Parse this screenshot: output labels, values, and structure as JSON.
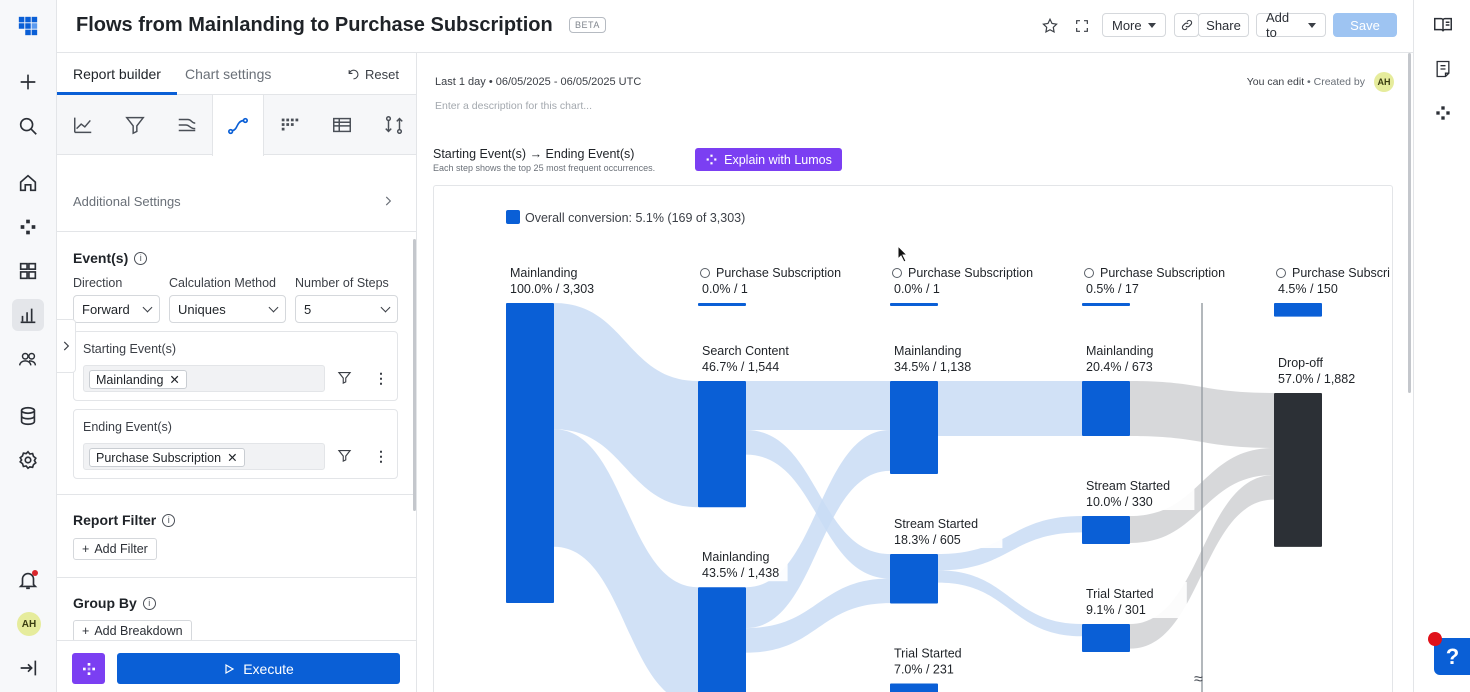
{
  "rail": {
    "logo": "grid-logo-icon",
    "items": [
      "plus-icon",
      "search-icon",
      "home-icon",
      "nodes-icon",
      "dashboard-icon",
      "reports-icon",
      "users-icon",
      "database-icon",
      "settings-icon",
      "bell-icon"
    ],
    "avatar": "AH"
  },
  "header": {
    "title": "Flows from Mainlanding to Purchase Subscription",
    "beta": "BETA",
    "more": "More",
    "share": "Share",
    "add_to": "Add to",
    "save": "Save"
  },
  "panel": {
    "tabs": [
      "Report builder",
      "Chart settings"
    ],
    "reset": "Reset",
    "additional_settings": "Additional Settings",
    "events": {
      "title": "Event(s)",
      "direction_label": "Direction",
      "direction": "Forward",
      "calc_label": "Calculation Method",
      "calc": "Uniques",
      "steps_label": "Number of Steps",
      "steps": "5",
      "starting_label": "Starting Event(s)",
      "starting_chip": "Mainlanding",
      "ending_label": "Ending Event(s)",
      "ending_chip": "Purchase Subscription"
    },
    "report_filter": {
      "title": "Report Filter",
      "button": "Add Filter"
    },
    "group_by": {
      "title": "Group By",
      "button": "Add Breakdown"
    },
    "execute": "Execute"
  },
  "main": {
    "daterange": "Last 1 day • 06/05/2025 - 06/05/2025 UTC",
    "description_placeholder": "Enter a description for this chart...",
    "can_edit": "You can edit",
    "created_by": " • Created by",
    "avatar": "AH",
    "flow_title": "Starting Event(s) → Ending Event(s)",
    "flow_subtitle": "Each step shows the top 25 most frequent occurrences.",
    "explain": "Explain with Lumos"
  },
  "colors": {
    "primary": "#0a5fd6",
    "lumos": "#7b3ff2",
    "flow": "#c9dcf5",
    "dropoff": "#2c3036",
    "gray_flow": "#d3d4d6"
  },
  "chart_data": {
    "type": "sankey",
    "legend": "Overall conversion: 5.1% (169 of 3,303)",
    "nodes": [
      {
        "id": "s0-mainlanding",
        "step": 0,
        "label": "Mainlanding",
        "value_text": "100.0% / 3,303",
        "value": 3303
      },
      {
        "id": "s1-purchase",
        "step": 1,
        "label": "Purchase Subscription",
        "value_text": "0.0% / 1",
        "value": 1,
        "goal": true
      },
      {
        "id": "s1-search",
        "step": 1,
        "label": "Search Content",
        "value_text": "46.7% / 1,544",
        "value": 1544
      },
      {
        "id": "s1-mainlanding",
        "step": 1,
        "label": "Mainlanding",
        "value_text": "43.5% / 1,438",
        "value": 1438
      },
      {
        "id": "s2-purchase",
        "step": 2,
        "label": "Purchase Subscription",
        "value_text": "0.0% / 1",
        "value": 1,
        "goal": true
      },
      {
        "id": "s2-mainlanding",
        "step": 2,
        "label": "Mainlanding",
        "value_text": "34.5% / 1,138",
        "value": 1138
      },
      {
        "id": "s2-stream",
        "step": 2,
        "label": "Stream Started",
        "value_text": "18.3% / 605",
        "value": 605
      },
      {
        "id": "s2-trial",
        "step": 2,
        "label": "Trial Started",
        "value_text": "7.0% / 231",
        "value": 231
      },
      {
        "id": "s3-purchase",
        "step": 3,
        "label": "Purchase Subscription",
        "value_text": "0.5% / 17",
        "value": 17,
        "goal": true
      },
      {
        "id": "s3-mainlanding",
        "step": 3,
        "label": "Mainlanding",
        "value_text": "20.4% / 673",
        "value": 673
      },
      {
        "id": "s3-stream",
        "step": 3,
        "label": "Stream Started",
        "value_text": "10.0% / 330",
        "value": 330
      },
      {
        "id": "s3-trial",
        "step": 3,
        "label": "Trial Started",
        "value_text": "9.1% / 301",
        "value": 301
      },
      {
        "id": "s4-purchase",
        "step": 4,
        "label": "Purchase Subscri",
        "value_text": "4.5% / 150",
        "value": 150,
        "goal": true
      },
      {
        "id": "s4-dropoff",
        "step": 4,
        "label": "Drop-off",
        "value_text": "57.0% / 1,882",
        "value": 1882,
        "dropoff": true
      }
    ],
    "links": [
      {
        "from": "s0-mainlanding",
        "to": "s1-search",
        "value": 1544
      },
      {
        "from": "s0-mainlanding",
        "to": "s1-mainlanding",
        "value": 1438
      },
      {
        "from": "s1-search",
        "to": "s2-mainlanding",
        "value": 600
      },
      {
        "from": "s1-search",
        "to": "s2-stream",
        "value": 300
      },
      {
        "from": "s1-mainlanding",
        "to": "s2-mainlanding",
        "value": 500
      },
      {
        "from": "s1-mainlanding",
        "to": "s2-stream",
        "value": 300
      },
      {
        "from": "s2-mainlanding",
        "to": "s3-mainlanding",
        "value": 673
      },
      {
        "from": "s2-stream",
        "to": "s3-stream",
        "value": 200
      },
      {
        "from": "s2-stream",
        "to": "s3-trial",
        "value": 150
      },
      {
        "from": "s3-mainlanding",
        "to": "s4-dropoff",
        "value": 673
      },
      {
        "from": "s3-stream",
        "to": "s4-dropoff",
        "value": 330
      },
      {
        "from": "s3-trial",
        "to": "s4-dropoff",
        "value": 301
      }
    ]
  }
}
